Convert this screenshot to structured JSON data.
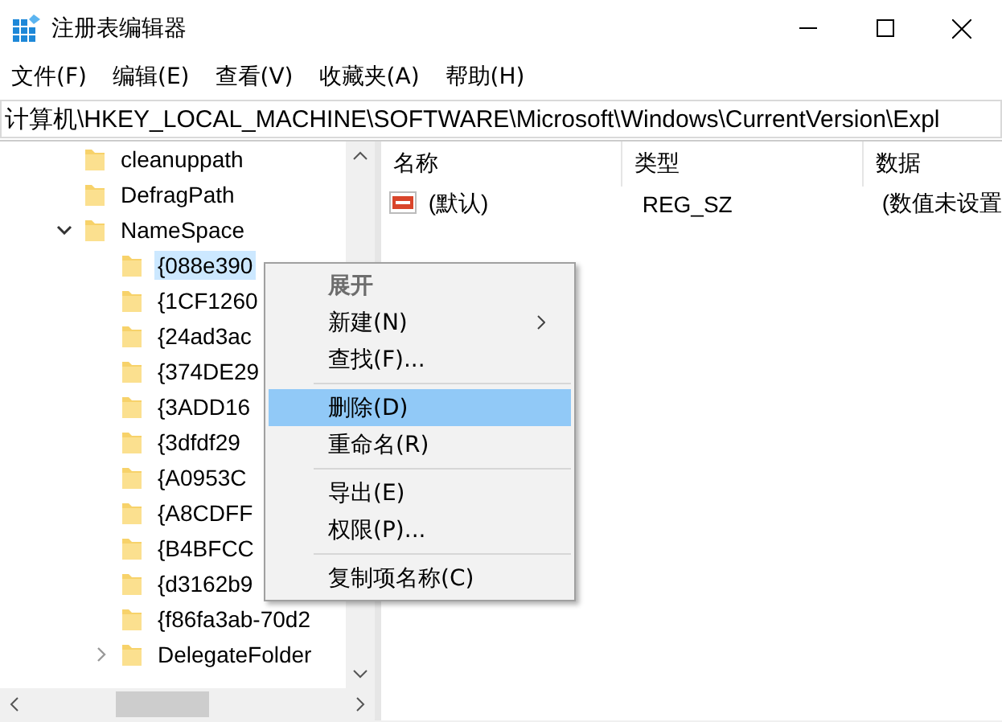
{
  "window": {
    "title": "注册表编辑器"
  },
  "menu_bar": [
    "文件(F)",
    "编辑(E)",
    "查看(V)",
    "收藏夹(A)",
    "帮助(H)"
  ],
  "address_bar": {
    "value": "计算机\\HKEY_LOCAL_MACHINE\\SOFTWARE\\Microsoft\\Windows\\CurrentVersion\\Expl"
  },
  "tree": [
    {
      "label": "cleanuppath",
      "expandable": false,
      "selected": false
    },
    {
      "label": "DefragPath",
      "expandable": false,
      "selected": false
    },
    {
      "label": "NameSpace",
      "expandable": true,
      "expanded": true,
      "selected": false,
      "children": [
        {
          "label": "{088e390",
          "expandable": false,
          "selected": true
        },
        {
          "label": "{1CF1260",
          "expandable": false,
          "selected": false
        },
        {
          "label": "{24ad3ac",
          "expandable": false,
          "selected": false
        },
        {
          "label": "{374DE29",
          "expandable": false,
          "selected": false
        },
        {
          "label": "{3ADD16",
          "expandable": false,
          "selected": false
        },
        {
          "label": "{3dfdf29",
          "expandable": false,
          "selected": false
        },
        {
          "label": "{A0953C",
          "expandable": false,
          "selected": false
        },
        {
          "label": "{A8CDFF",
          "expandable": false,
          "selected": false
        },
        {
          "label": "{B4BFCC",
          "expandable": false,
          "selected": false
        },
        {
          "label": "{d3162b9",
          "expandable": false,
          "selected": false
        },
        {
          "label": "{f86fa3ab-70d2",
          "expandable": false,
          "selected": false
        },
        {
          "label": "DelegateFolder",
          "expandable": true,
          "expanded": false,
          "selected": false
        }
      ]
    }
  ],
  "values_table": {
    "columns": [
      "名称",
      "类型",
      "数据"
    ],
    "rows": [
      {
        "name": "(默认)",
        "type": "REG_SZ",
        "data": "(数值未设置"
      }
    ]
  },
  "context_menu": [
    {
      "kind": "item",
      "label": "展开",
      "default": true,
      "submenu": false,
      "selected": false
    },
    {
      "kind": "item",
      "label": "新建(N)",
      "default": false,
      "submenu": true,
      "selected": false
    },
    {
      "kind": "item",
      "label": "查找(F)...",
      "default": false,
      "submenu": false,
      "selected": false
    },
    {
      "kind": "separator"
    },
    {
      "kind": "item",
      "label": "删除(D)",
      "default": false,
      "submenu": false,
      "selected": true
    },
    {
      "kind": "item",
      "label": "重命名(R)",
      "default": false,
      "submenu": false,
      "selected": false
    },
    {
      "kind": "separator"
    },
    {
      "kind": "item",
      "label": "导出(E)",
      "default": false,
      "submenu": false,
      "selected": false
    },
    {
      "kind": "item",
      "label": "权限(P)...",
      "default": false,
      "submenu": false,
      "selected": false
    },
    {
      "kind": "separator"
    },
    {
      "kind": "item",
      "label": "复制项名称(C)",
      "default": false,
      "submenu": false,
      "selected": false
    }
  ]
}
